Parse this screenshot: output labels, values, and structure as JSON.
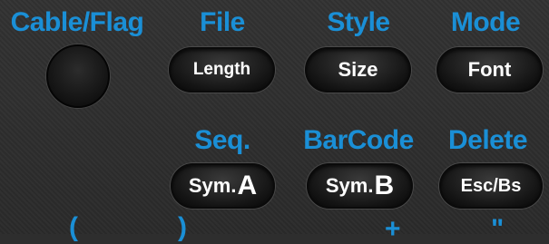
{
  "labels": {
    "cable_flag": "Cable/Flag",
    "file": "File",
    "style": "Style",
    "mode": "Mode",
    "seq": "Seq.",
    "barcode": "BarCode",
    "delete": "Delete"
  },
  "keys": {
    "length": "Length",
    "size": "Size",
    "font": "Font",
    "sym_a_prefix": "Sym.",
    "sym_a_letter": "A",
    "sym_b_prefix": "Sym.",
    "sym_b_letter": "B",
    "esc_bs": "Esc/Bs"
  },
  "bottom_row": {
    "paren_open": "(",
    "paren_close": ")",
    "plus": "+",
    "quote": "\""
  },
  "colors": {
    "label_blue": "#1a8fd6",
    "background": "#2e2e2e",
    "key_face": "#141414"
  }
}
